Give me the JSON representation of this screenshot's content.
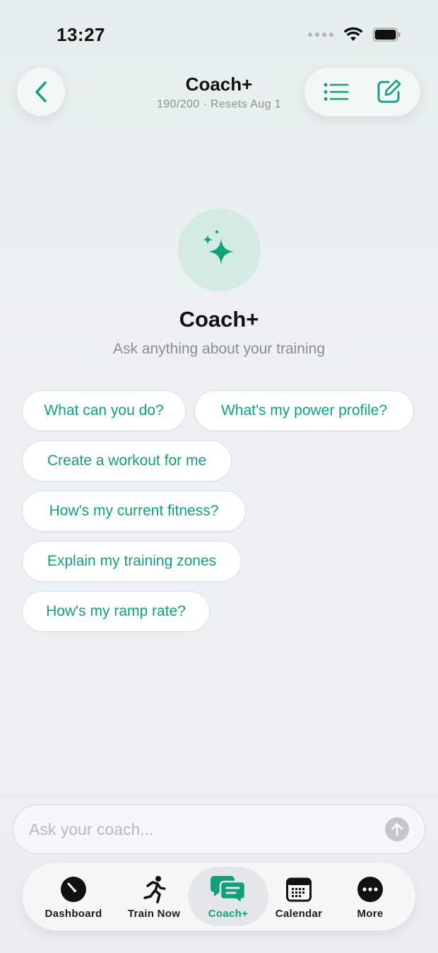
{
  "status_bar": {
    "time": "13:27"
  },
  "header": {
    "title": "Coach+",
    "subtitle": "190/200 · Resets Aug 1"
  },
  "hero": {
    "title": "Coach+",
    "subtitle": "Ask anything about your training"
  },
  "suggestions": [
    "What can you do?",
    "What's my power profile?",
    "Create a workout for me",
    "How's my current fitness?",
    "Explain my training zones",
    "How's my ramp rate?"
  ],
  "composer": {
    "placeholder": "Ask your coach..."
  },
  "tabs": [
    {
      "label": "Dashboard",
      "icon": "gauge-icon"
    },
    {
      "label": "Train Now",
      "icon": "runner-icon"
    },
    {
      "label": "Coach+",
      "icon": "chat-bubbles-icon",
      "active": true
    },
    {
      "label": "Calendar",
      "icon": "calendar-icon"
    },
    {
      "label": "More",
      "icon": "ellipsis-circle-icon"
    }
  ],
  "colors": {
    "accent": "#11a079",
    "hero_circle": "#d4ebe3",
    "text_primary": "#111111",
    "text_secondary": "#8a8d91"
  }
}
